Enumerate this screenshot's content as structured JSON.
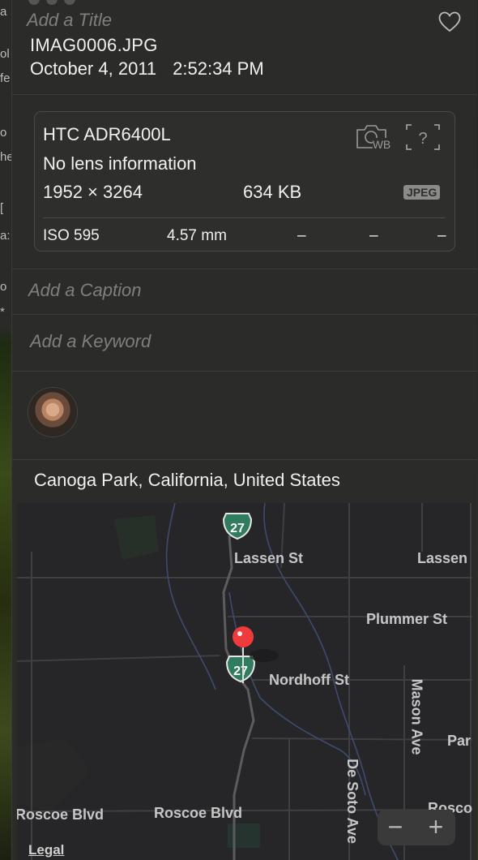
{
  "info": {
    "title_placeholder": "Add a Title",
    "filename": "IMAG0006.JPG",
    "date": "October 4, 2011",
    "time": "2:52:34 PM"
  },
  "exif": {
    "camera": "HTC ADR6400L",
    "lens": "No lens information",
    "dimensions": "1952 × 3264",
    "file_size": "634 KB",
    "format_badge": "JPEG",
    "stats": [
      "ISO 595",
      "4.57 mm",
      "–",
      "–",
      "–"
    ],
    "wb_label": "WB",
    "q_label": "?"
  },
  "caption_placeholder": "Add a Caption",
  "keyword_placeholder": "Add a Keyword",
  "location": "Canoga Park, California, United States",
  "map": {
    "shield_number": "27",
    "streets": {
      "lassen": "Lassen St",
      "lassen_right": "Lassen",
      "plummer": "Plummer St",
      "nordhoff": "Nordhoff St",
      "mason": "Mason Ave",
      "par": "Par",
      "desoto": "De Soto Ave",
      "roscoe_left": "Roscoe Blvd",
      "roscoe_mid": "Roscoe Blvd",
      "roscoe_right": "Rosco"
    },
    "zoom_out": "−",
    "zoom_in": "+",
    "legal": "Legal"
  },
  "bg_fragments": [
    "a",
    "ol",
    "fe",
    "o",
    "he",
    "[",
    "a:",
    "o",
    "*"
  ],
  "colors": {
    "panel": "#2b2b29",
    "map_bg": "#262628",
    "shield_green": "#2f7d5e",
    "pin_red": "#ef3b3b"
  }
}
